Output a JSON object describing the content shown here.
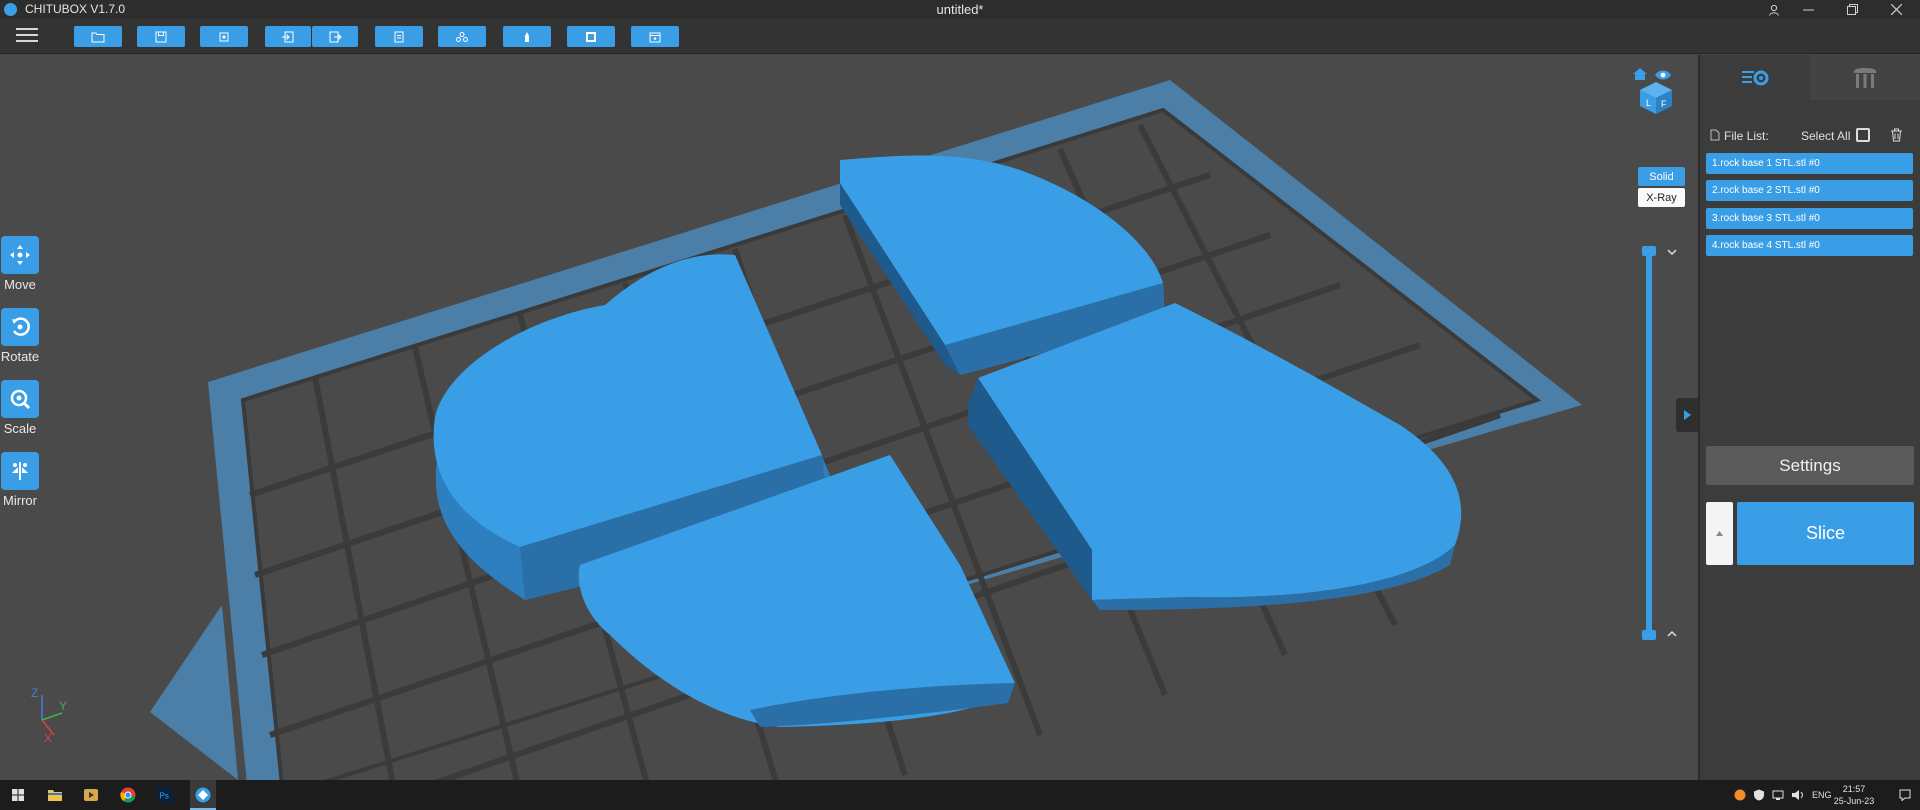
{
  "titlebar": {
    "app_name": "CHITUBOX V1.7.0",
    "document_title": "untitled*"
  },
  "viewport": {
    "tools": [
      {
        "label": "Move",
        "icon": "move-icon"
      },
      {
        "label": "Rotate",
        "icon": "rotate-icon"
      },
      {
        "label": "Scale",
        "icon": "scale-icon"
      },
      {
        "label": "Mirror",
        "icon": "mirror-icon"
      }
    ],
    "view_modes": {
      "solid": "Solid",
      "xray": "X-Ray"
    },
    "axis": {
      "z": "Z",
      "y": "Y",
      "x": "X"
    }
  },
  "panel": {
    "file_list_label": "File List:",
    "select_all_label": "Select All",
    "files": [
      "1.rock base 1 STL.stl #0",
      "2.rock base 2 STL.stl #0",
      "3.rock base 3 STL.stl #0",
      "4.rock base 4 STL.stl #0"
    ],
    "settings_label": "Settings",
    "slice_label": "Slice"
  },
  "taskbar": {
    "language": "ENG",
    "time": "21:57",
    "date": "25-Jun-23"
  },
  "colors": {
    "accent": "#3a9ee6",
    "viewport_bg": "#4a4a4a",
    "panel_bg": "#3c3c3c"
  }
}
